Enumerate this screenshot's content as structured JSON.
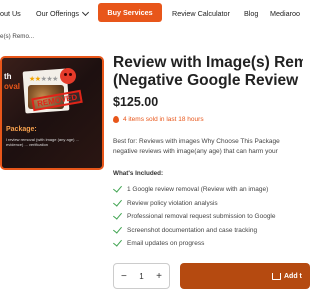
{
  "nav": {
    "about": "out Us",
    "offerings": "Our Offerings",
    "buy": "Buy Services",
    "calculator": "Review Calculator",
    "blog": "Blog",
    "brand": "Mediaroo"
  },
  "breadcrumb": "e(s) Remo...",
  "product_image": {
    "line1": "th",
    "line2": "oval",
    "stamp": "REMOVED",
    "package": "Package:",
    "desc": "l review removal (with image (any age) ... evidence) ... verification"
  },
  "product": {
    "title_line1": "Review with Image(s) Rem",
    "title_line2": "(Negative Google Review",
    "price": "$125.00",
    "sold": "4 items sold in last 18 hours",
    "bestfor_line1": "Best for: Reviews with images Why Choose This Package",
    "bestfor_line2": "negative reviews with image(any age) that can harm your",
    "included_heading": "What's Included:",
    "included": [
      "1 Google review removal (Review with an image)",
      "Review policy violation analysis",
      "Professional removal request submission to Google",
      "Screenshot documentation and case tracking",
      "Email updates on progress"
    ]
  },
  "cart": {
    "quantity": "1",
    "minus": "−",
    "plus": "+",
    "add_label": "Add t"
  },
  "colors": {
    "accent": "#e8561a",
    "add_button": "#b54a10",
    "check": "#3ea34f"
  }
}
